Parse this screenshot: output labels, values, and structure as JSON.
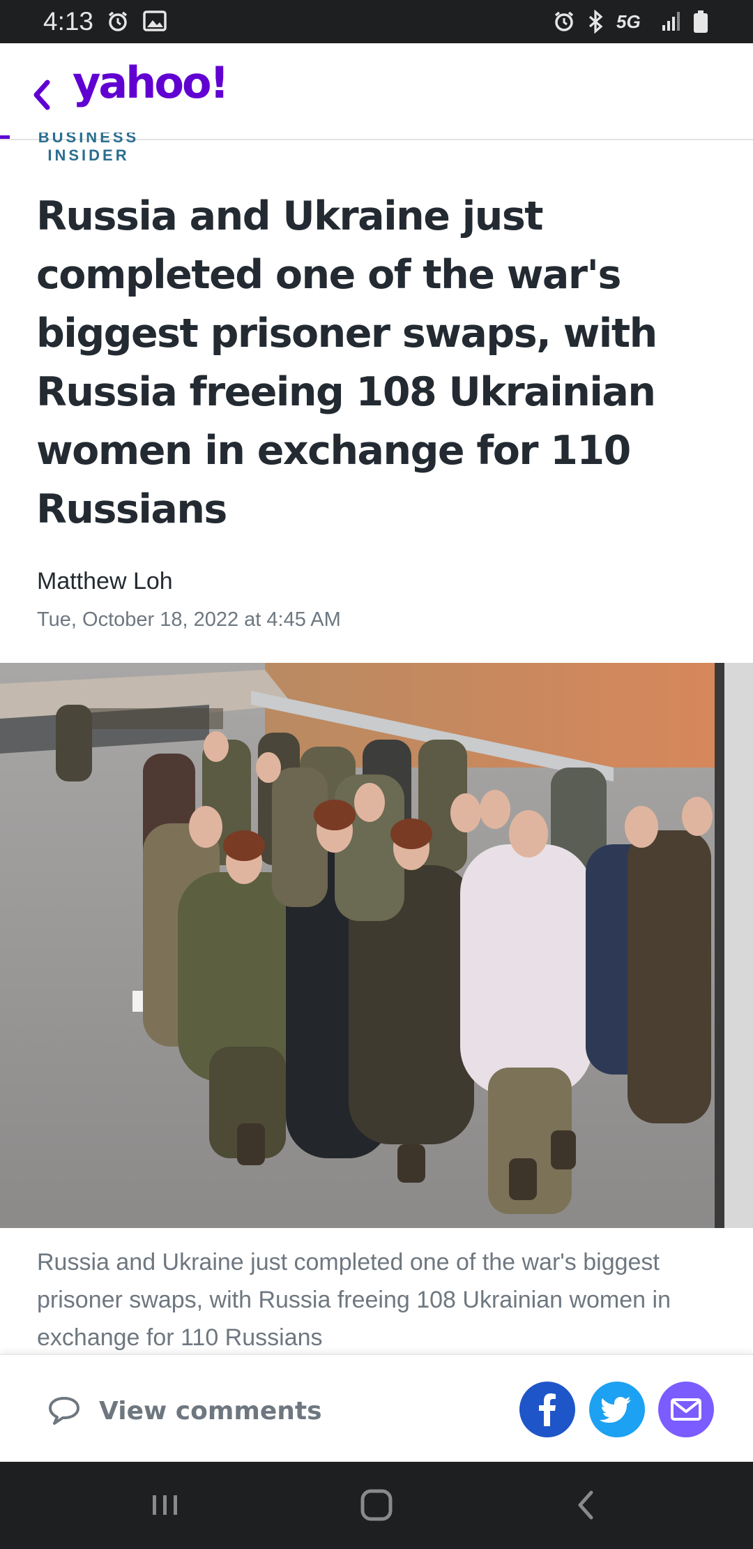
{
  "status_bar": {
    "time": "4:13",
    "network": "5G",
    "icons": [
      "alarm-icon",
      "image-icon",
      "alarm-icon",
      "bluetooth-icon",
      "signal-icon",
      "battery-icon"
    ]
  },
  "header": {
    "brand": "yahoo!",
    "back_icon": "chevron-left-icon",
    "accent_color": "#6001d2"
  },
  "article": {
    "publisher_line1": "BUSINESS",
    "publisher_line2": "INSIDER",
    "title": "Russia and Ukraine just completed one of the war's biggest prisoner swaps, with Russia freeing 108 Ukrainian women in exchange for 110 Russians",
    "author": "Matthew Loh",
    "date": "Tue, October 18, 2022 at 4:45 AM",
    "caption": "Russia and Ukraine just completed one of the war's biggest prisoner swaps, with Russia freeing 108 Ukrainian women in exchange for 110 Russians"
  },
  "bottom_bar": {
    "comments_label": "View comments",
    "share": [
      {
        "name": "facebook",
        "color": "#1e55c9"
      },
      {
        "name": "twitter",
        "color": "#1da1f2"
      },
      {
        "name": "email",
        "color": "#7b5cff"
      }
    ]
  },
  "nav": {
    "buttons": [
      "recents-icon",
      "home-icon",
      "back-icon"
    ]
  }
}
